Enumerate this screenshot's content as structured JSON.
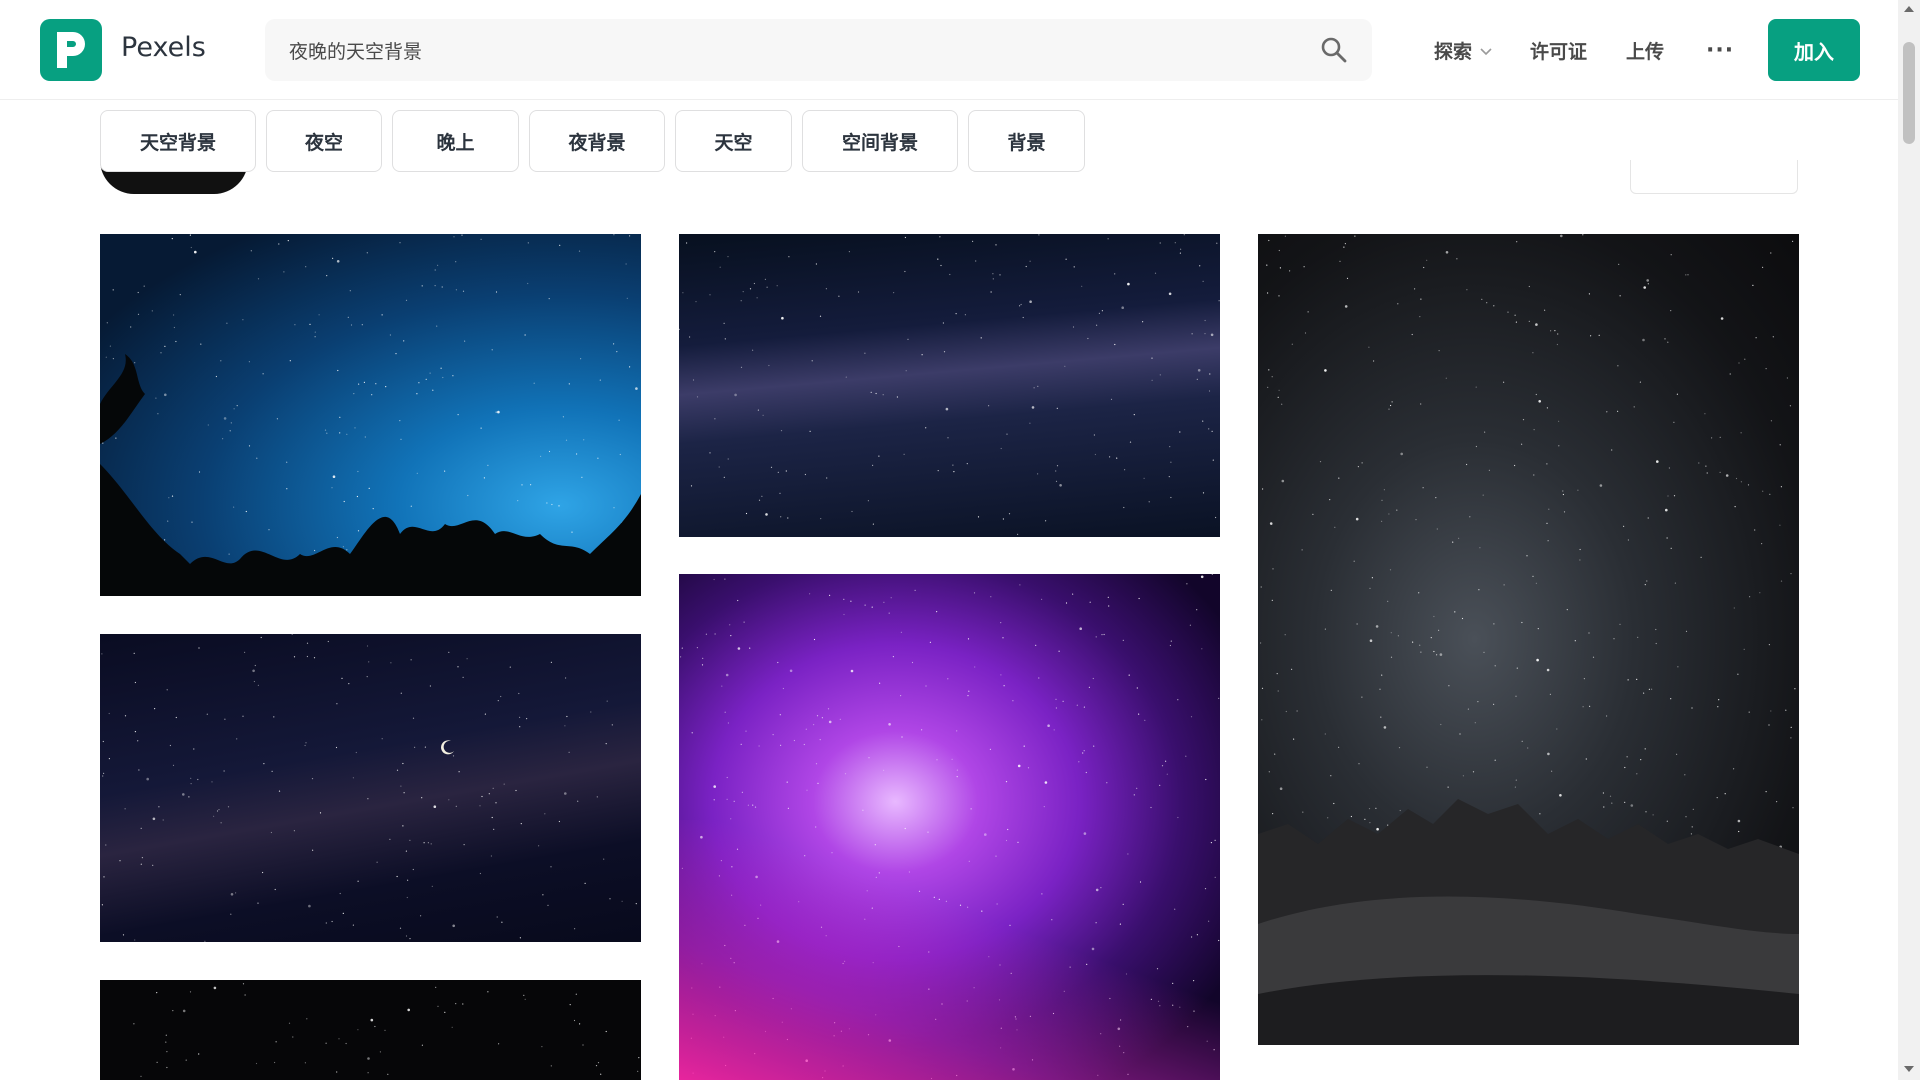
{
  "header": {
    "brand": "Pexels",
    "logo_icon": "pexels-logo-icon",
    "search": {
      "value": "夜晚的天空背景",
      "icon": "search-icon"
    },
    "nav": {
      "explore": "探索",
      "license": "许可证",
      "upload": "上传",
      "more": "···"
    },
    "join_label": "加入",
    "accent_color": "#07a081"
  },
  "tags": [
    "天空背景",
    "夜空",
    "晚上",
    "夜背景",
    "天空",
    "空间背景",
    "背景"
  ],
  "photos": [
    {
      "subject": "starry-sky-with-trees"
    },
    {
      "subject": "milky-way-band"
    },
    {
      "subject": "night-sky-over-mountains"
    },
    {
      "subject": "moon-and-milky-way"
    },
    {
      "subject": "purple-milky-way"
    },
    {
      "subject": "dark-starry-sky"
    }
  ]
}
